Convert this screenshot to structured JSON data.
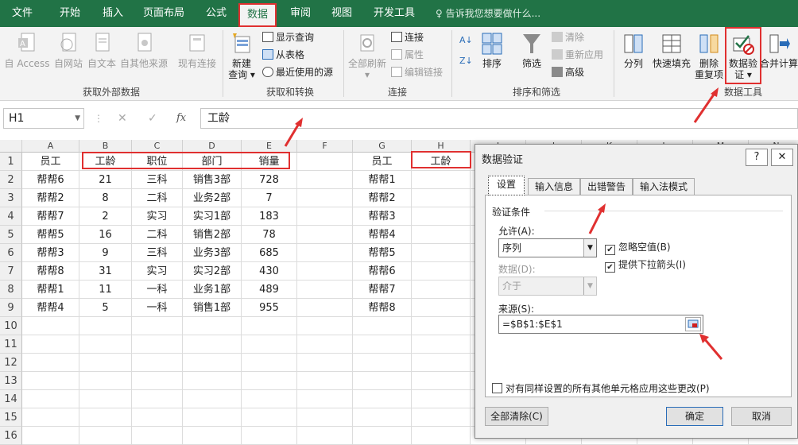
{
  "tabs": [
    "文件",
    "开始",
    "插入",
    "页面布局",
    "公式",
    "数据",
    "审阅",
    "视图",
    "开发工具"
  ],
  "active_tab": "数据",
  "tell_me": "告诉我您想要做什么...",
  "ribbon": {
    "get_external": {
      "access": "自 Access",
      "web": "自网站",
      "text": "自文本",
      "other": "自其他来源",
      "existing": "现有连接",
      "label": "获取外部数据"
    },
    "transform": {
      "new_query_1": "新建",
      "new_query_2": "查询",
      "show_query": "显示查询",
      "from_table": "从表格",
      "recent": "最近使用的源",
      "label": "获取和转换"
    },
    "connections": {
      "refresh": "全部刷新",
      "conn": "连接",
      "props": "属性",
      "edit_links": "编辑链接",
      "label": "连接"
    },
    "sort_filter": {
      "sort": "排序",
      "filter": "筛选",
      "clear": "清除",
      "reapply": "重新应用",
      "advanced": "高级",
      "label": "排序和筛选"
    },
    "data_tools": {
      "split": "分列",
      "flash": "快速填充",
      "remove_dup_1": "删除",
      "remove_dup_2": "重复项",
      "validation_1": "数据验",
      "validation_2": "证",
      "consolidate": "合并计算",
      "label": "数据工具"
    }
  },
  "formula_bar": {
    "name_box": "H1",
    "cancel": "✕",
    "enter": "✓",
    "fx": "fx",
    "content": "工龄"
  },
  "grid": {
    "columns": [
      "A",
      "B",
      "C",
      "D",
      "E",
      "F",
      "G",
      "H",
      "I",
      "J",
      "K",
      "L",
      "M",
      "N"
    ],
    "rows": [
      [
        "员工",
        "工龄",
        "职位",
        "部门",
        "销量",
        "",
        "员工",
        "工龄"
      ],
      [
        "帮帮6",
        "21",
        "三科",
        "销售3部",
        "728",
        "",
        "帮帮1",
        ""
      ],
      [
        "帮帮2",
        "8",
        "二科",
        "业务2部",
        "7",
        "",
        "帮帮2",
        ""
      ],
      [
        "帮帮7",
        "2",
        "实习",
        "实习1部",
        "183",
        "",
        "帮帮3",
        ""
      ],
      [
        "帮帮5",
        "16",
        "二科",
        "销售2部",
        "78",
        "",
        "帮帮4",
        ""
      ],
      [
        "帮帮3",
        "9",
        "三科",
        "业务3部",
        "685",
        "",
        "帮帮5",
        ""
      ],
      [
        "帮帮8",
        "31",
        "实习",
        "实习2部",
        "430",
        "",
        "帮帮6",
        ""
      ],
      [
        "帮帮1",
        "11",
        "一科",
        "业务1部",
        "489",
        "",
        "帮帮7",
        ""
      ],
      [
        "帮帮4",
        "5",
        "一科",
        "销售1部",
        "955",
        "",
        "帮帮8",
        ""
      ],
      [
        "",
        "",
        "",
        "",
        "",
        "",
        "",
        ""
      ],
      [
        "",
        "",
        "",
        "",
        "",
        "",
        "",
        ""
      ],
      [
        "",
        "",
        "",
        "",
        "",
        "",
        "",
        ""
      ],
      [
        "",
        "",
        "",
        "",
        "",
        "",
        "",
        ""
      ],
      [
        "",
        "",
        "",
        "",
        "",
        "",
        "",
        ""
      ],
      [
        "",
        "",
        "",
        "",
        "",
        "",
        "",
        ""
      ],
      [
        "",
        "",
        "",
        "",
        "",
        "",
        "",
        ""
      ]
    ],
    "row_numbers": [
      "1",
      "2",
      "3",
      "4",
      "5",
      "6",
      "7",
      "8",
      "9",
      "10",
      "11",
      "12",
      "13",
      "14",
      "15",
      "16"
    ]
  },
  "dialog": {
    "title": "数据验证",
    "help": "?",
    "close": "✕",
    "tabs": [
      "设置",
      "输入信息",
      "出错警告",
      "输入法模式"
    ],
    "group_label": "验证条件",
    "allow_label": "允许(A):",
    "allow_value": "序列",
    "ignore_blank": "忽略空值(B)",
    "dropdown_arrow": "提供下拉箭头(I)",
    "data_label": "数据(D):",
    "data_value": "介于",
    "source_label": "来源(S):",
    "source_value": "=$B$1:$E$1",
    "apply_all": "对有同样设置的所有其他单元格应用这些更改(P)",
    "clear_all": "全部清除(C)",
    "ok": "确定",
    "cancel": "取消"
  },
  "colors": {
    "excel_green": "#217346",
    "highlight_red": "#e03030"
  }
}
